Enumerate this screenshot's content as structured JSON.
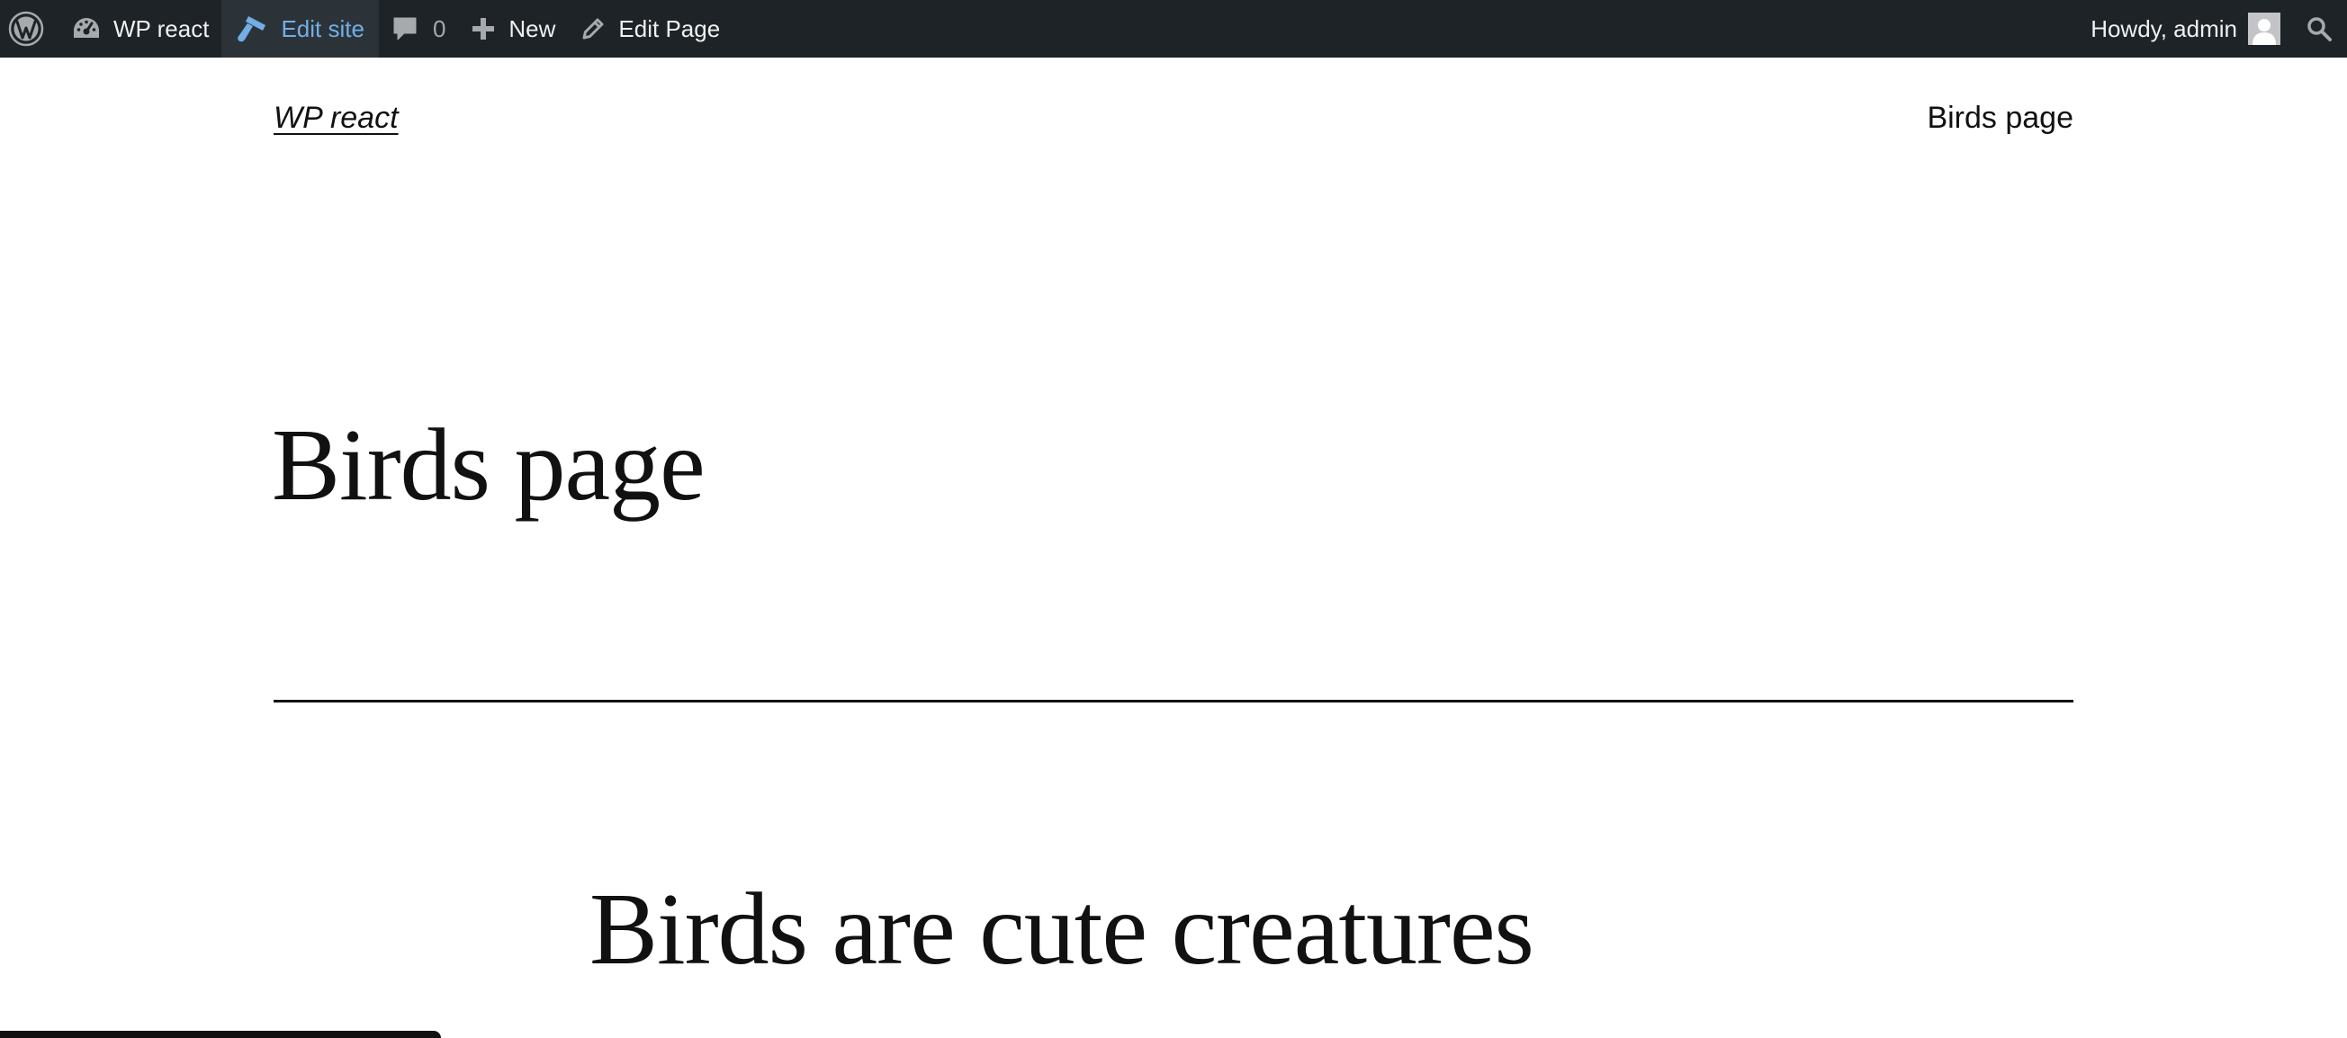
{
  "admin_bar": {
    "wp_logo_icon": "wordpress-logo-icon",
    "site_name": "WP react",
    "site_icon": "dashboard-gauge-icon",
    "edit_site_label": "Edit site",
    "edit_site_icon": "brush-icon",
    "comments_count": "0",
    "comments_icon": "speech-bubble-icon",
    "new_label": "New",
    "new_icon": "plus-icon",
    "edit_page_label": "Edit Page",
    "edit_page_icon": "pencil-icon",
    "howdy_label": "Howdy, admin",
    "avatar_icon": "user-avatar-icon",
    "search_icon": "search-icon",
    "colors": {
      "background": "#1d2327",
      "text": "#f0f0f1",
      "active_item": "#72aee6",
      "active_background": "#2c3338",
      "muted": "#a7aaad"
    }
  },
  "header": {
    "site_title": "WP react",
    "nav_items": [
      {
        "label": "Birds page"
      }
    ]
  },
  "main": {
    "page_title": "Birds page",
    "content_heading": "Birds are cute creatures"
  }
}
